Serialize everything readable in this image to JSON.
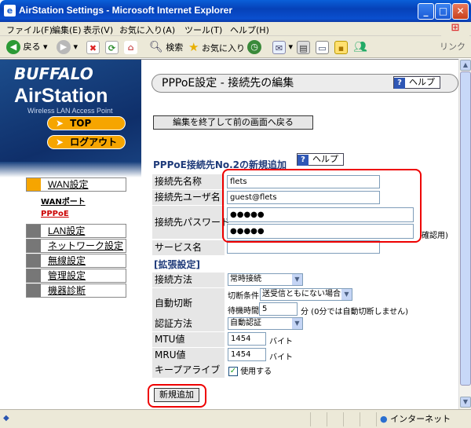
{
  "window": {
    "title": "AirStation Settings - Microsoft Internet Explorer",
    "app_icon": "ie-icon",
    "controls": [
      "minimize",
      "maximize",
      "close"
    ]
  },
  "menu": {
    "items": [
      "ファイル(F)",
      "編集(E)",
      "表示(V)",
      "お気に入り(A)",
      "ツール(T)",
      "ヘルプ(H)"
    ]
  },
  "toolbar": {
    "back_label": "戻る",
    "search_label": "検索",
    "favorites_label": "お気に入り",
    "links_label": "リンク"
  },
  "brand": {
    "logo": "BUFFALO",
    "product": "AirStation",
    "subtitle": "Wireless LAN Access Point"
  },
  "sidebar": {
    "top_label": "TOP",
    "logout_label": "ログアウト",
    "wan_label": "WAN設定",
    "wan_port_label": "WANポート",
    "pppoe_label": "PPPoE",
    "lan_label": "LAN設定",
    "network_label": "ネットワーク設定",
    "wireless_label": "無線設定",
    "admin_label": "管理設定",
    "diag_label": "機器診断"
  },
  "header": {
    "title": "PPPoE設定 - 接続先の編集",
    "help_label": "ヘルプ"
  },
  "back_button_label": "編集を終了して前の画面へ戻る",
  "section": {
    "title": "PPPoE接続先No.2の新規追加",
    "help_label": "ヘルプ"
  },
  "form": {
    "connection_name_label": "接続先名称",
    "connection_name_value": "flets",
    "username_label": "接続先ユーザ名",
    "username_value": "guest@flets",
    "password_label": "接続先パスワード",
    "password_value": "●●●●●",
    "password_confirm_value": "●●●●●",
    "password_confirm_suffix": "確認用)",
    "service_name_label": "サービス名",
    "service_name_value": ""
  },
  "advanced": {
    "title": "[拡張設定]",
    "connect_method_label": "接続方法",
    "connect_method_value": "常時接続",
    "auto_disconnect_label": "自動切断",
    "disconnect_condition_label": "切断条件",
    "disconnect_condition_value": "送受信ともにない場合",
    "wait_time_label": "待機時間",
    "wait_time_value": "5",
    "wait_time_unit": "分 (0分では自動切断しません)",
    "auth_label": "認証方法",
    "auth_value": "自動認証",
    "mtu_label": "MTU値",
    "mtu_value": "1454",
    "mtu_unit": "バイト",
    "mru_label": "MRU値",
    "mru_value": "1454",
    "mru_unit": "バイト",
    "keepalive_label": "キープアライブ",
    "keepalive_checkbox_label": "使用する"
  },
  "add_button_label": "新規追加",
  "status": {
    "zone": "インターネット"
  },
  "colors": {
    "titlebar": "#0a4fcf",
    "accent_orange": "#f6a500",
    "section_blue": "#1f3b7a",
    "highlight_red": "#e00000"
  }
}
